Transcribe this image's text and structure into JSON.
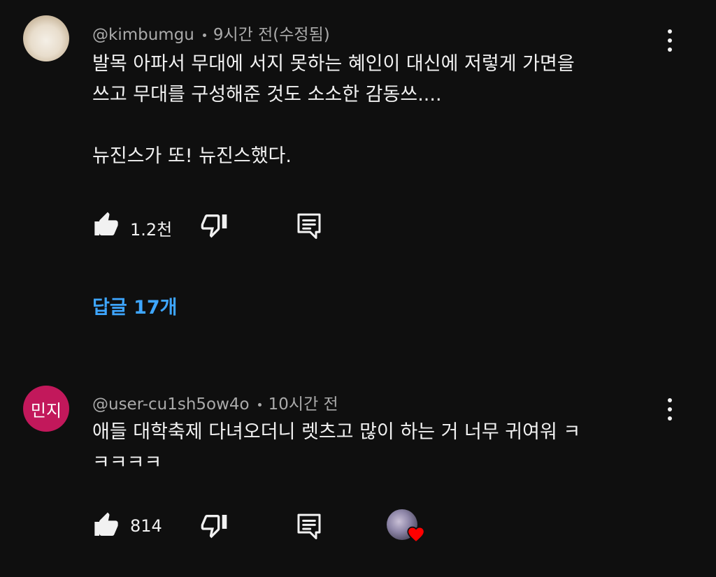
{
  "comments": [
    {
      "author": "@kimbumgu",
      "time": "9시간 전(수정됨)",
      "text": "발목 아파서 무대에 서지 못하는 혜인이 대신에 저렇게 가면을\n쓰고 무대를 구성해준 것도 소소한 감동쓰....\n\n뉴진스가 또! 뉴진스했다.",
      "likes": "1.2천",
      "replies_label": "답글 17개",
      "avatar": "profile-photo"
    },
    {
      "author": "@user-cu1sh5ow4o",
      "time": "10시간 전",
      "text": "애들 대학축제 다녀오더니 렛츠고 많이 하는 거 너무 귀여워 ㅋ\nㅋㅋㅋㅋ",
      "likes": "814",
      "avatar_text": "민지",
      "creator_heart": true
    }
  ],
  "icons": {
    "like": "thumbs-up-icon",
    "dislike": "thumbs-down-icon",
    "reply": "reply-comment-icon",
    "more": "more-vertical-icon",
    "heart": "heart-icon"
  },
  "colors": {
    "background": "#0f0f0f",
    "text": "#f1f1f1",
    "meta": "#aaaaaa",
    "link": "#3ea6ff",
    "avatar_bg": "#c2185b",
    "heart": "#ff0000"
  }
}
